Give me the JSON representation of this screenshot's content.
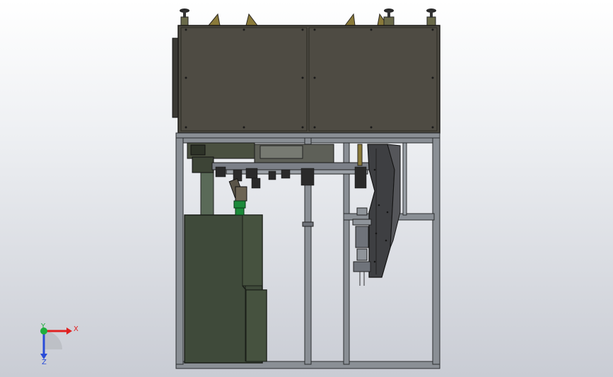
{
  "triad": {
    "x_label": "X",
    "y_label": "Y",
    "z_label": "Z",
    "x_color": "#e02020",
    "y_color": "#1fae3c",
    "z_color": "#2a4cd8"
  },
  "colors": {
    "frame": "#8a8f95",
    "frame_edge": "#2a2c2e",
    "enclosure": "#4c4a42",
    "enclosure_edge": "#1c1b18",
    "cabinet": "#3f4a3a",
    "brass": "#8a7a3a",
    "chute": "#3e3f42",
    "green_part": "#1c8a3a"
  }
}
